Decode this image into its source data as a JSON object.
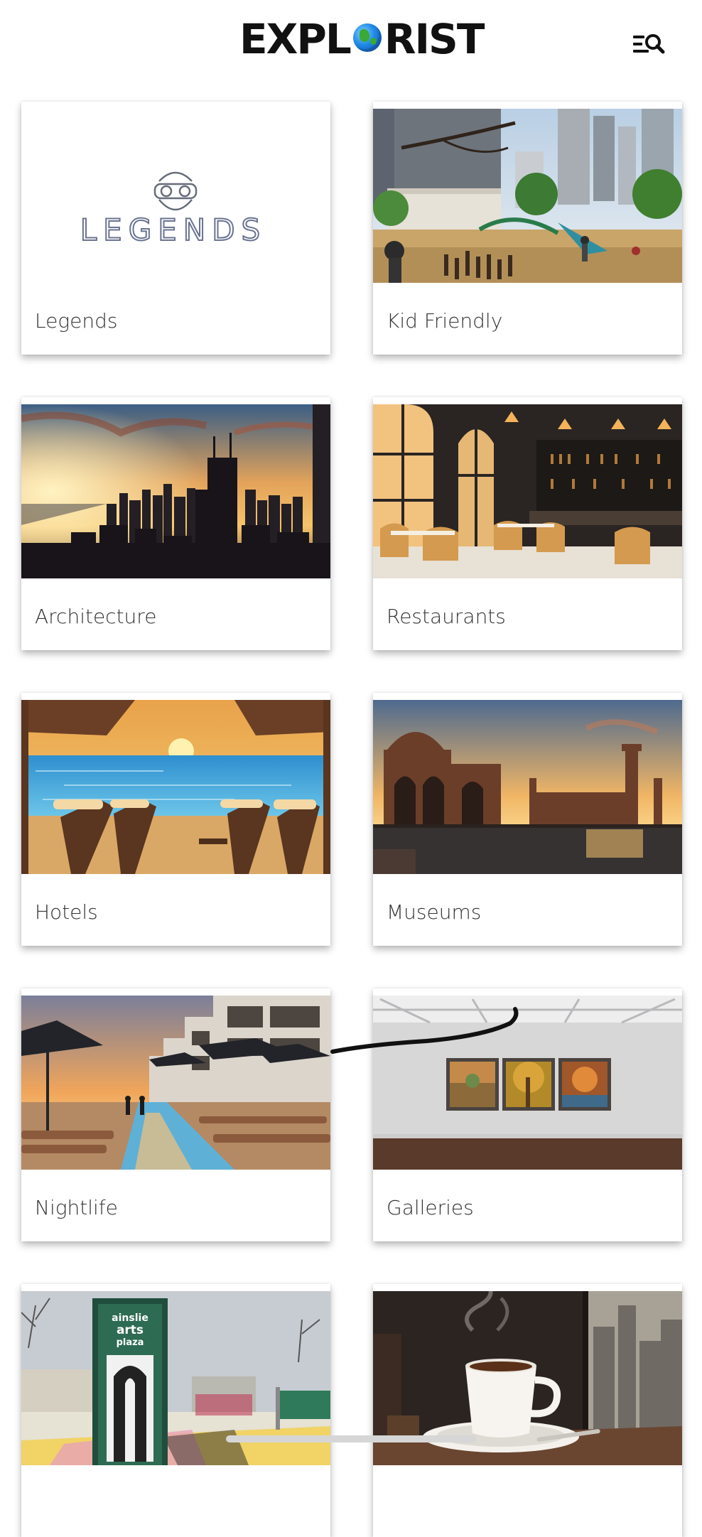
{
  "app": {
    "logo_left": "EXPL",
    "logo_right": "RIST"
  },
  "header": {
    "menu_icon": "menu-search-icon"
  },
  "categories": [
    {
      "label": "Legends",
      "image": "legends-logo-image"
    },
    {
      "label": "Kid Friendly",
      "image": "city-playground-image"
    },
    {
      "label": "Architecture",
      "image": "skyline-sunset-image"
    },
    {
      "label": "Restaurants",
      "image": "restaurant-interior-image"
    },
    {
      "label": "Hotels",
      "image": "beach-loungers-image"
    },
    {
      "label": "Museums",
      "image": "palace-of-arts-image"
    },
    {
      "label": "Nightlife",
      "image": "hotel-pool-sunset-image"
    },
    {
      "label": "Galleries",
      "image": "gallery-paintings-image"
    },
    {
      "label": "",
      "image": "arts-plaza-image"
    },
    {
      "label": "",
      "image": "coffee-cup-image"
    }
  ],
  "legends_card": {
    "logo_text": "LEGENDS"
  },
  "plaza_sign": {
    "line1": "ainslie",
    "line2": "arts",
    "line3": "plaza"
  },
  "colors": {
    "background": "#ffffff",
    "label_text": "#333333",
    "logo_text": "#111111",
    "globe_blue": "#1e88e5",
    "globe_green": "#3aa935"
  }
}
